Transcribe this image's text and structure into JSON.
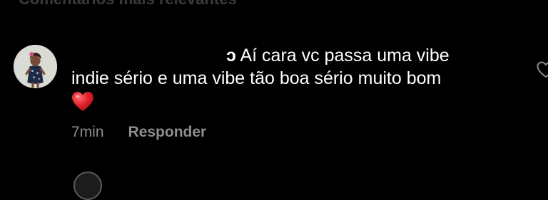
{
  "header": {
    "title": "Comentários mais relevantes"
  },
  "comment": {
    "username_fragment": "ɔ",
    "text_line1": "Aí cara vc passa uma vibe",
    "text_line2": "indie sério e uma vibe tão boa sério muito bom",
    "emoji": "red-heart-emoji",
    "time": "7min",
    "reply_label": "Responder",
    "like_icon": "heart-outline-icon"
  },
  "colors": {
    "background": "#000000",
    "text": "#ffffff",
    "muted": "#8e8e8e",
    "heart_red": "#e0202b"
  }
}
